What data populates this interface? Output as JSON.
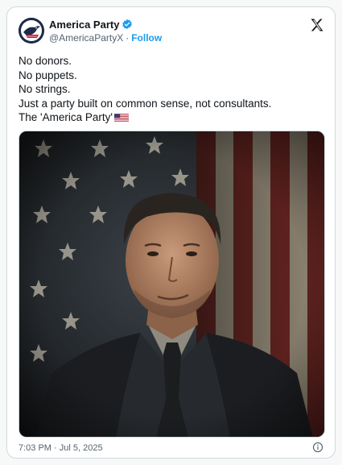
{
  "account": {
    "display_name": "America Party",
    "handle": "@AmericaPartyX",
    "separator": "·",
    "follow_label": "Follow"
  },
  "tweet": {
    "lines": [
      "No donors.",
      "No puppets.",
      "No strings.",
      "Just a party built on common sense, not consultants.",
      "The 'America Party'"
    ],
    "timestamp": "7:03 PM · Jul 5, 2025"
  },
  "icons": {
    "verified": "verified-badge-icon",
    "platform": "x-logo-icon",
    "info": "info-icon",
    "flag": "us-flag-emoji"
  },
  "colors": {
    "accent": "#1d9bf0",
    "text": "#0f1419",
    "muted": "#536471",
    "border": "#cfd9de"
  }
}
